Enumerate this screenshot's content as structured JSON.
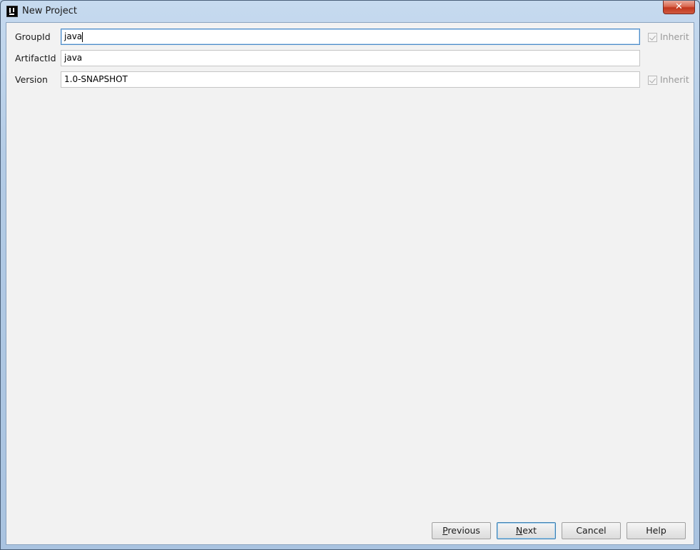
{
  "window": {
    "title": "New Project",
    "close_symbol": "✕"
  },
  "icons": {
    "app": "intellij-icon",
    "close": "close-icon",
    "check": "checkmark-icon"
  },
  "form": {
    "group_id": {
      "label": "GroupId",
      "value": "java",
      "inherit_label": "Inherit",
      "inherit_checked": true,
      "inherit_enabled": false
    },
    "artifact_id": {
      "label": "ArtifactId",
      "value": "java"
    },
    "version": {
      "label": "Version",
      "value": "1.0-SNAPSHOT",
      "inherit_label": "Inherit",
      "inherit_checked": true,
      "inherit_enabled": false
    }
  },
  "buttons": {
    "previous": {
      "mnemonic": "P",
      "rest": "revious"
    },
    "next": {
      "mnemonic": "N",
      "rest": "ext"
    },
    "cancel": {
      "label": "Cancel"
    },
    "help": {
      "label": "Help"
    }
  },
  "colors": {
    "focus_border": "#4d8cc8",
    "dialog_background": "#f2f2f2",
    "close_button": "#c1361d"
  }
}
